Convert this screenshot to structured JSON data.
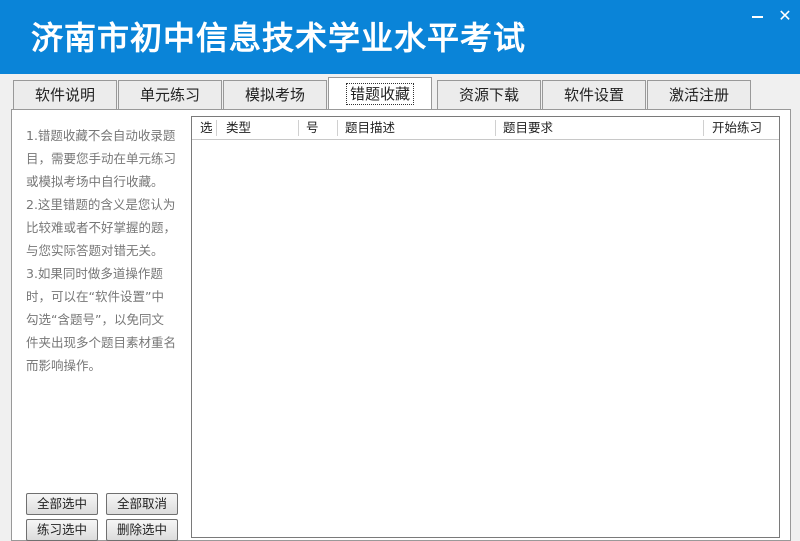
{
  "app": {
    "title": "济南市初中信息技术学业水平考试",
    "close_glyph": "✕"
  },
  "tabs": [
    {
      "label": "软件说明"
    },
    {
      "label": "单元练习"
    },
    {
      "label": "模拟考场"
    },
    {
      "label": "错题收藏",
      "active": true
    },
    {
      "label": "资源下载"
    },
    {
      "label": "软件设置"
    },
    {
      "label": "激活注册"
    }
  ],
  "notes": [
    "1.错题收藏不会自动收录题目，需要您手动在单元练习或模拟考场中自行收藏。",
    "2.这里错题的含义是您认为比较难或者不好掌握的题，与您实际答题对错无关。",
    "3.如果同时做多道操作题时，可以在“软件设置”中勾选“含题号”，以免同文件夹出现多个题目素材重名而影响操作。"
  ],
  "table": {
    "columns": [
      "选",
      "类型",
      "号",
      "题目描述",
      "题目要求",
      "开始练习"
    ],
    "rows": []
  },
  "buttons": {
    "select_all": "全部选中",
    "deselect_all": "全部取消",
    "practice_selected": "练习选中",
    "delete_selected": "删除选中"
  }
}
